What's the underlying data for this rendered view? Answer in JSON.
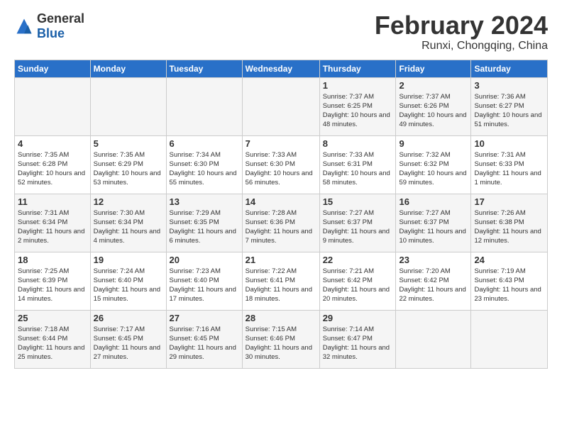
{
  "logo": {
    "general": "General",
    "blue": "Blue"
  },
  "title": "February 2024",
  "subtitle": "Runxi, Chongqing, China",
  "days_header": [
    "Sunday",
    "Monday",
    "Tuesday",
    "Wednesday",
    "Thursday",
    "Friday",
    "Saturday"
  ],
  "weeks": [
    [
      {
        "day": "",
        "info": ""
      },
      {
        "day": "",
        "info": ""
      },
      {
        "day": "",
        "info": ""
      },
      {
        "day": "",
        "info": ""
      },
      {
        "day": "1",
        "sunrise": "Sunrise: 7:37 AM",
        "sunset": "Sunset: 6:25 PM",
        "daylight": "Daylight: 10 hours and 48 minutes."
      },
      {
        "day": "2",
        "sunrise": "Sunrise: 7:37 AM",
        "sunset": "Sunset: 6:26 PM",
        "daylight": "Daylight: 10 hours and 49 minutes."
      },
      {
        "day": "3",
        "sunrise": "Sunrise: 7:36 AM",
        "sunset": "Sunset: 6:27 PM",
        "daylight": "Daylight: 10 hours and 51 minutes."
      }
    ],
    [
      {
        "day": "4",
        "sunrise": "Sunrise: 7:35 AM",
        "sunset": "Sunset: 6:28 PM",
        "daylight": "Daylight: 10 hours and 52 minutes."
      },
      {
        "day": "5",
        "sunrise": "Sunrise: 7:35 AM",
        "sunset": "Sunset: 6:29 PM",
        "daylight": "Daylight: 10 hours and 53 minutes."
      },
      {
        "day": "6",
        "sunrise": "Sunrise: 7:34 AM",
        "sunset": "Sunset: 6:30 PM",
        "daylight": "Daylight: 10 hours and 55 minutes."
      },
      {
        "day": "7",
        "sunrise": "Sunrise: 7:33 AM",
        "sunset": "Sunset: 6:30 PM",
        "daylight": "Daylight: 10 hours and 56 minutes."
      },
      {
        "day": "8",
        "sunrise": "Sunrise: 7:33 AM",
        "sunset": "Sunset: 6:31 PM",
        "daylight": "Daylight: 10 hours and 58 minutes."
      },
      {
        "day": "9",
        "sunrise": "Sunrise: 7:32 AM",
        "sunset": "Sunset: 6:32 PM",
        "daylight": "Daylight: 10 hours and 59 minutes."
      },
      {
        "day": "10",
        "sunrise": "Sunrise: 7:31 AM",
        "sunset": "Sunset: 6:33 PM",
        "daylight": "Daylight: 11 hours and 1 minute."
      }
    ],
    [
      {
        "day": "11",
        "sunrise": "Sunrise: 7:31 AM",
        "sunset": "Sunset: 6:34 PM",
        "daylight": "Daylight: 11 hours and 2 minutes."
      },
      {
        "day": "12",
        "sunrise": "Sunrise: 7:30 AM",
        "sunset": "Sunset: 6:34 PM",
        "daylight": "Daylight: 11 hours and 4 minutes."
      },
      {
        "day": "13",
        "sunrise": "Sunrise: 7:29 AM",
        "sunset": "Sunset: 6:35 PM",
        "daylight": "Daylight: 11 hours and 6 minutes."
      },
      {
        "day": "14",
        "sunrise": "Sunrise: 7:28 AM",
        "sunset": "Sunset: 6:36 PM",
        "daylight": "Daylight: 11 hours and 7 minutes."
      },
      {
        "day": "15",
        "sunrise": "Sunrise: 7:27 AM",
        "sunset": "Sunset: 6:37 PM",
        "daylight": "Daylight: 11 hours and 9 minutes."
      },
      {
        "day": "16",
        "sunrise": "Sunrise: 7:27 AM",
        "sunset": "Sunset: 6:37 PM",
        "daylight": "Daylight: 11 hours and 10 minutes."
      },
      {
        "day": "17",
        "sunrise": "Sunrise: 7:26 AM",
        "sunset": "Sunset: 6:38 PM",
        "daylight": "Daylight: 11 hours and 12 minutes."
      }
    ],
    [
      {
        "day": "18",
        "sunrise": "Sunrise: 7:25 AM",
        "sunset": "Sunset: 6:39 PM",
        "daylight": "Daylight: 11 hours and 14 minutes."
      },
      {
        "day": "19",
        "sunrise": "Sunrise: 7:24 AM",
        "sunset": "Sunset: 6:40 PM",
        "daylight": "Daylight: 11 hours and 15 minutes."
      },
      {
        "day": "20",
        "sunrise": "Sunrise: 7:23 AM",
        "sunset": "Sunset: 6:40 PM",
        "daylight": "Daylight: 11 hours and 17 minutes."
      },
      {
        "day": "21",
        "sunrise": "Sunrise: 7:22 AM",
        "sunset": "Sunset: 6:41 PM",
        "daylight": "Daylight: 11 hours and 18 minutes."
      },
      {
        "day": "22",
        "sunrise": "Sunrise: 7:21 AM",
        "sunset": "Sunset: 6:42 PM",
        "daylight": "Daylight: 11 hours and 20 minutes."
      },
      {
        "day": "23",
        "sunrise": "Sunrise: 7:20 AM",
        "sunset": "Sunset: 6:42 PM",
        "daylight": "Daylight: 11 hours and 22 minutes."
      },
      {
        "day": "24",
        "sunrise": "Sunrise: 7:19 AM",
        "sunset": "Sunset: 6:43 PM",
        "daylight": "Daylight: 11 hours and 23 minutes."
      }
    ],
    [
      {
        "day": "25",
        "sunrise": "Sunrise: 7:18 AM",
        "sunset": "Sunset: 6:44 PM",
        "daylight": "Daylight: 11 hours and 25 minutes."
      },
      {
        "day": "26",
        "sunrise": "Sunrise: 7:17 AM",
        "sunset": "Sunset: 6:45 PM",
        "daylight": "Daylight: 11 hours and 27 minutes."
      },
      {
        "day": "27",
        "sunrise": "Sunrise: 7:16 AM",
        "sunset": "Sunset: 6:45 PM",
        "daylight": "Daylight: 11 hours and 29 minutes."
      },
      {
        "day": "28",
        "sunrise": "Sunrise: 7:15 AM",
        "sunset": "Sunset: 6:46 PM",
        "daylight": "Daylight: 11 hours and 30 minutes."
      },
      {
        "day": "29",
        "sunrise": "Sunrise: 7:14 AM",
        "sunset": "Sunset: 6:47 PM",
        "daylight": "Daylight: 11 hours and 32 minutes."
      },
      {
        "day": "",
        "info": ""
      },
      {
        "day": "",
        "info": ""
      }
    ]
  ]
}
